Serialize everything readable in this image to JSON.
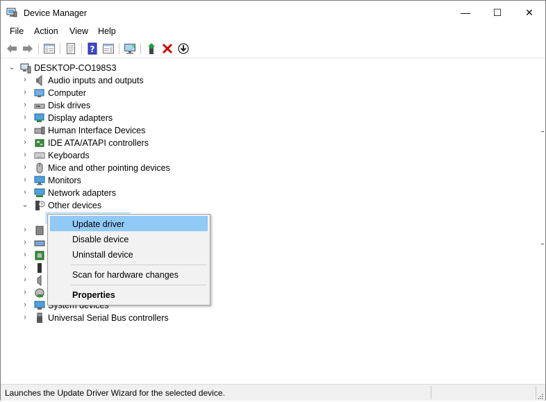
{
  "window": {
    "title": "Device Manager",
    "minimize_glyph": "—",
    "maximize_glyph": "☐",
    "close_glyph": "✕"
  },
  "menu": [
    "File",
    "Action",
    "View",
    "Help"
  ],
  "toolbar": {
    "icons": [
      "back-arrow-icon",
      "forward-arrow-icon",
      "show-hide-console-tree-icon",
      "properties-icon",
      "help-icon",
      "action-pane-icon",
      "monitor-icon",
      "update-driver-icon",
      "uninstall-icon",
      "download-icon"
    ]
  },
  "tree": {
    "root": "DESKTOP-CO198S3",
    "items": [
      {
        "label": "Audio inputs and outputs",
        "icon": "speaker-icon"
      },
      {
        "label": "Computer",
        "icon": "computer-icon"
      },
      {
        "label": "Disk drives",
        "icon": "disk-drive-icon"
      },
      {
        "label": "Display adapters",
        "icon": "display-adapter-icon"
      },
      {
        "label": "Human Interface Devices",
        "icon": "hid-icon"
      },
      {
        "label": "IDE ATA/ATAPI controllers",
        "icon": "ide-controller-icon"
      },
      {
        "label": "Keyboards",
        "icon": "keyboard-icon"
      },
      {
        "label": "Mice and other pointing devices",
        "icon": "mouse-icon"
      },
      {
        "label": "Monitors",
        "icon": "monitor-icon"
      },
      {
        "label": "Network adapters",
        "icon": "network-adapter-icon"
      },
      {
        "label": "Other devices",
        "icon": "unknown-device-icon",
        "expanded": true
      }
    ],
    "after_menu_items": [
      {
        "label": "System devices",
        "icon": "system-devices-icon"
      },
      {
        "label": "Universal Serial Bus controllers",
        "icon": "usb-icon"
      }
    ]
  },
  "context_menu": {
    "items": [
      "Update driver",
      "Disable device",
      "Uninstall device",
      "Scan for hardware changes",
      "Properties"
    ],
    "highlighted": "Update driver",
    "bold": "Properties"
  },
  "status_bar": {
    "text": "Launches the Update Driver Wizard for the selected device."
  },
  "colors": {
    "highlight": "#91c9f7",
    "menu_bg": "#f2f2f2",
    "uninstall_red": "#d40000"
  }
}
